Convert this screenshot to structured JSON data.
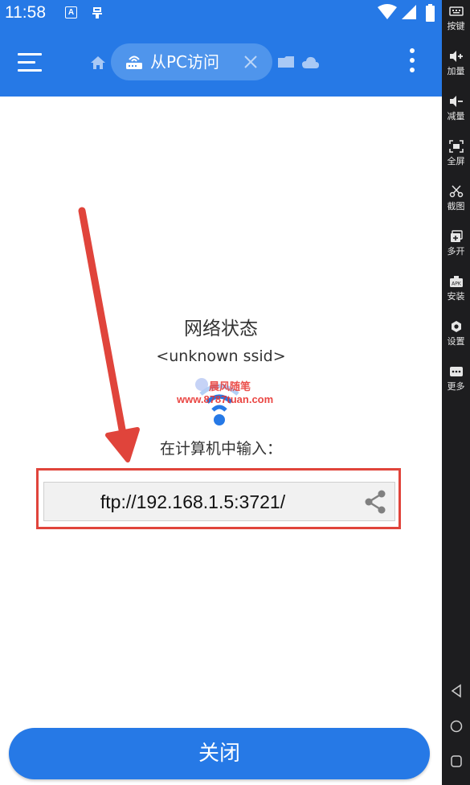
{
  "status_bar": {
    "time": "11:58",
    "notif_a": "A"
  },
  "toolbar": {
    "tab_label": "从PC访问"
  },
  "main": {
    "status_title": "网络状态",
    "ssid": "<unknown ssid>",
    "instruction": "在计算机中输入：",
    "url": "ftp://192.168.1.5:3721/",
    "watermark_line1": "晨风随笔",
    "watermark_line2": "www.8787tuan.com"
  },
  "close_button_label": "关闭",
  "side_panel": {
    "items": [
      {
        "icon": "keyboard-icon",
        "label": "按键"
      },
      {
        "icon": "volume-up-icon",
        "label": "加量"
      },
      {
        "icon": "volume-down-icon",
        "label": "减量"
      },
      {
        "icon": "fullscreen-icon",
        "label": "全屏"
      },
      {
        "icon": "scissors-icon",
        "label": "截图"
      },
      {
        "icon": "multi-window-icon",
        "label": "多开"
      },
      {
        "icon": "apk-icon",
        "label": "安装"
      },
      {
        "icon": "gear-icon",
        "label": "设置"
      },
      {
        "icon": "more-icon",
        "label": "更多"
      }
    ]
  },
  "colors": {
    "primary": "#2679e6",
    "annotation_red": "#e0443b",
    "panel": "#1d1d1f"
  }
}
